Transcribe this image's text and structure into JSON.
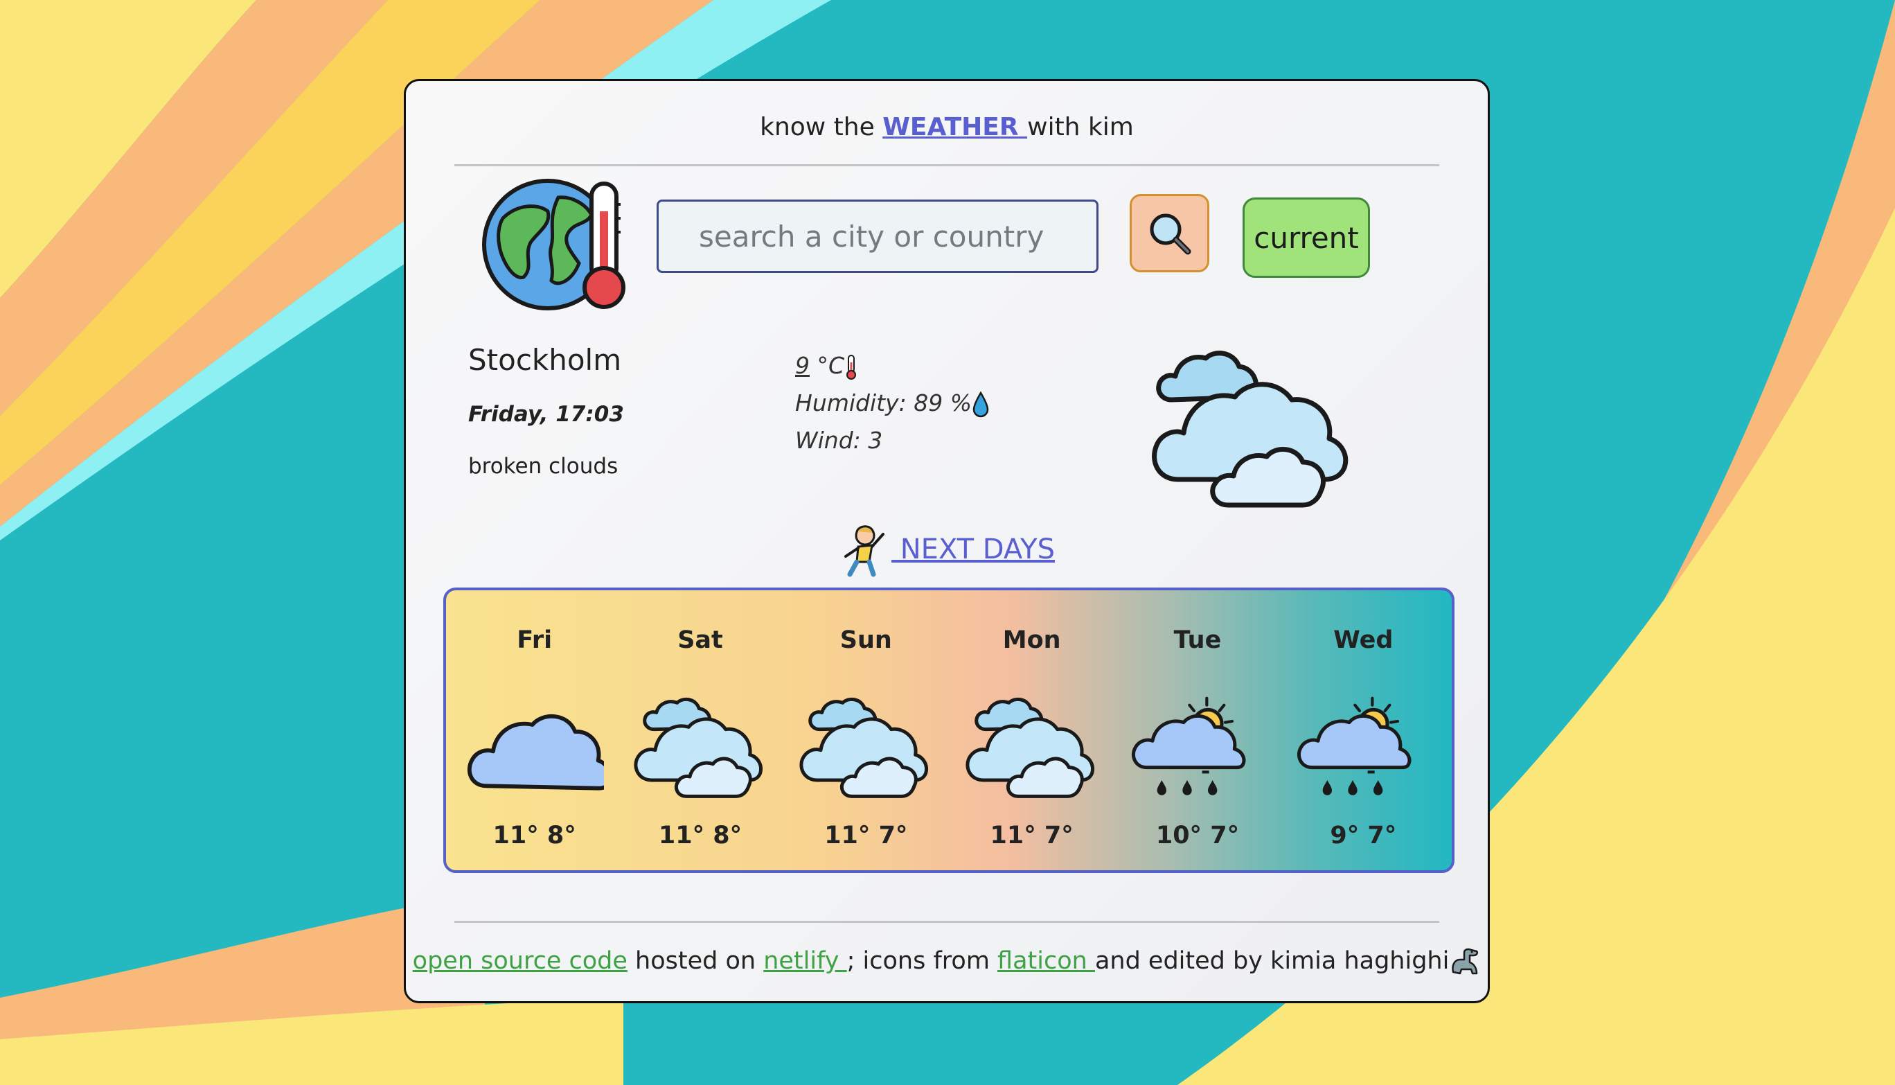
{
  "header": {
    "prefix": "know the",
    "brand": "WEATHER ",
    "suffix": "with kim"
  },
  "search": {
    "placeholder": "search a city or country",
    "value": ""
  },
  "buttons": {
    "current_label": "current"
  },
  "current": {
    "city": "Stockholm",
    "datetime": "Friday, 17:03",
    "description": "broken clouds",
    "temperature": "9",
    "unit": "°C",
    "humidity_label": "Humidity:",
    "humidity_value": "89 %",
    "wind_label": "Wind:",
    "wind_value": "3",
    "icon": "broken-clouds-icon"
  },
  "next_days": {
    "label": " NEXT DAYS",
    "icon": "stretching-kid-icon"
  },
  "forecast": [
    {
      "day": "Fri",
      "temps": "11° 8°",
      "icon": "cloud-icon"
    },
    {
      "day": "Sat",
      "temps": "11° 8°",
      "icon": "broken-clouds-icon"
    },
    {
      "day": "Sun",
      "temps": "11° 7°",
      "icon": "broken-clouds-icon"
    },
    {
      "day": "Mon",
      "temps": "11° 7°",
      "icon": "broken-clouds-icon"
    },
    {
      "day": "Tue",
      "temps": "10° 7°",
      "icon": "sun-rain-icon"
    },
    {
      "day": "Wed",
      "temps": "9° 7°",
      "icon": "sun-rain-icon"
    }
  ],
  "footer": {
    "source_link": "open source code",
    "hosted_text": " hosted on ",
    "netlify_link": "netlify ",
    "icons_text": "; icons from ",
    "flaticon_link": "flaticon ",
    "edited_text": "and edited by kimia haghighi"
  },
  "colors": {
    "accent": "#5a5fd0",
    "link_green": "#3fa345",
    "search_button": "#f6c6a6",
    "current_button": "#9fe37a",
    "background_teal": "#24b9c1"
  }
}
